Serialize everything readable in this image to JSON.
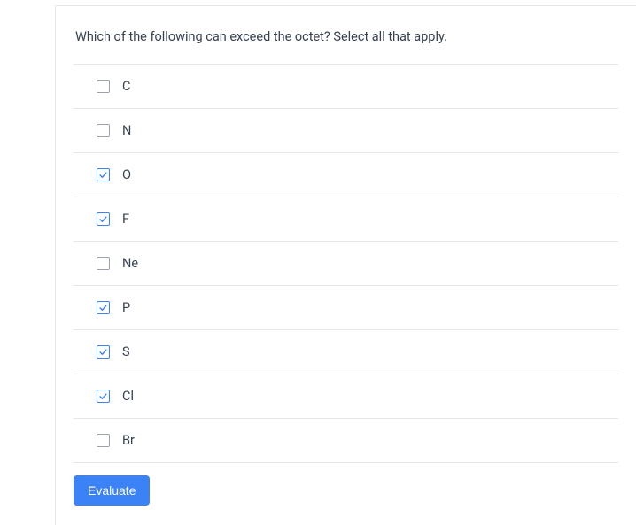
{
  "question": {
    "text": "Which of the following can exceed the octet?  Select all that apply.",
    "options": [
      {
        "label": "C",
        "checked": false
      },
      {
        "label": "N",
        "checked": false
      },
      {
        "label": "O",
        "checked": true
      },
      {
        "label": "F",
        "checked": true
      },
      {
        "label": "Ne",
        "checked": false
      },
      {
        "label": "P",
        "checked": true
      },
      {
        "label": "S",
        "checked": true
      },
      {
        "label": "Cl",
        "checked": true
      },
      {
        "label": "Br",
        "checked": false
      }
    ]
  },
  "buttons": {
    "evaluate_label": "Evaluate"
  },
  "colors": {
    "accent": "#3b82f6",
    "border": "#e5e7eb",
    "text": "#374151"
  }
}
